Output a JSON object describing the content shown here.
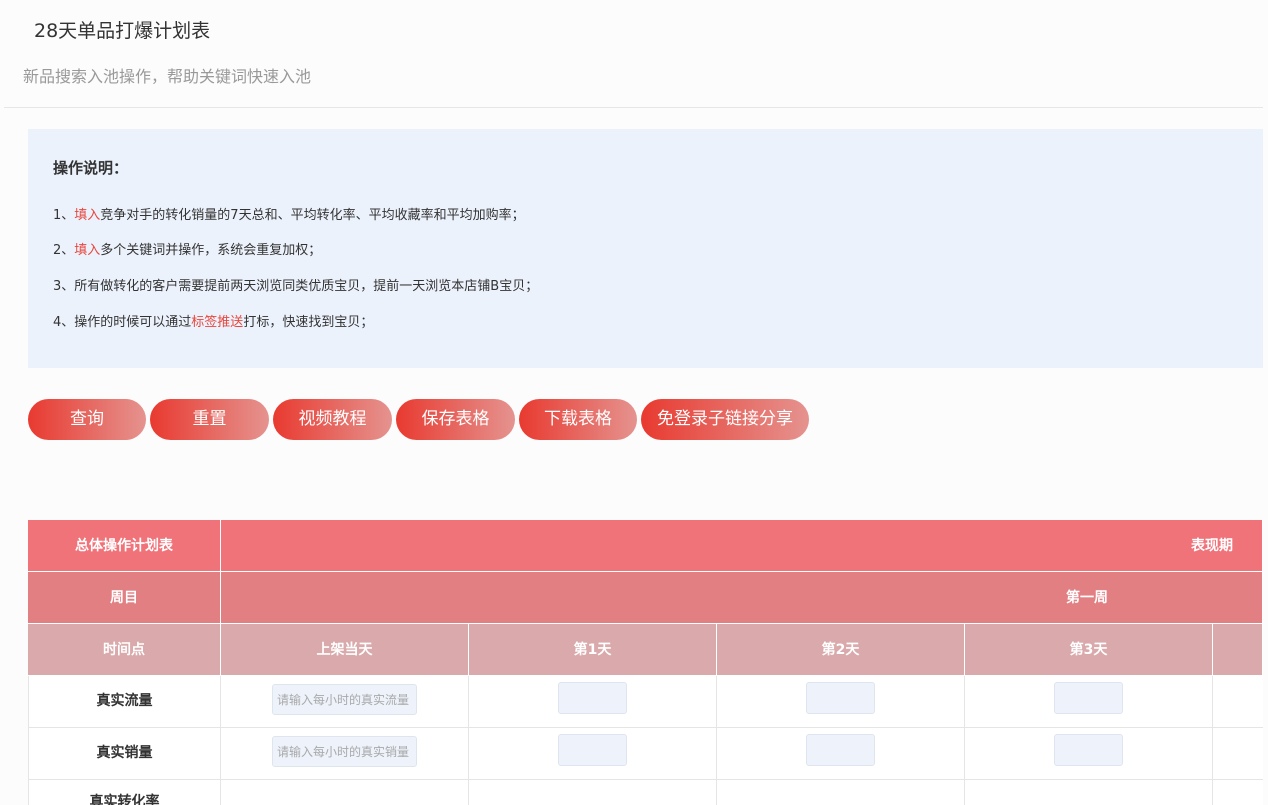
{
  "page": {
    "title": "28天单品打爆计划表",
    "subtitle": "新品搜索入池操作，帮助关键词快速入池"
  },
  "instructions": {
    "heading": "操作说明：",
    "lines": [
      {
        "num": "1、",
        "red": "填入",
        "rest": "竞争对手的转化销量的7天总和、平均转化率、平均收藏率和平均加购率；"
      },
      {
        "num": "2、",
        "red": "填入",
        "rest": "多个关键词并操作，系统会重复加权；"
      },
      {
        "num": "3、",
        "text": "所有做转化的客户需要提前两天浏览同类优质宝贝，提前一天浏览本店铺B宝贝；"
      },
      {
        "num": "4、",
        "pre": "操作的时候可以通过",
        "red": "标签推送",
        "rest": "打标，快速找到宝贝；"
      }
    ]
  },
  "buttons": {
    "query": "查询",
    "reset": "重置",
    "video": "视频教程",
    "save": "保存表格",
    "download": "下载表格",
    "share": "免登录子链接分享"
  },
  "table": {
    "header1": {
      "label": "总体操作计划表",
      "span": "表现期"
    },
    "header2": {
      "label": "周目",
      "span": "第一周"
    },
    "header3": {
      "label": "时间点",
      "cols": [
        "上架当天",
        "第1天",
        "第2天",
        "第3天"
      ]
    },
    "rows": [
      {
        "label": "真实流量",
        "placeholder": "请输入每小时的真实流量"
      },
      {
        "label": "真实销量",
        "placeholder": "请输入每小时的真实销量"
      },
      {
        "label": "真实转化率"
      }
    ]
  },
  "colors": {
    "button_gradient_start": "#e83a30",
    "button_gradient_end": "#e5938f",
    "header_row1": "#f0737a",
    "header_row2": "#e27f83",
    "header_row3": "#daa9ab",
    "instructions_bg": "#ecf2fc",
    "highlight_red": "#e8463c"
  }
}
